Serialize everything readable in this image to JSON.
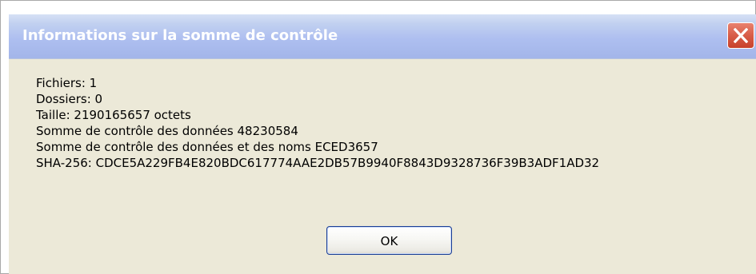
{
  "dialog": {
    "title": "Informations sur la somme de contrôle",
    "close_icon": "close-icon",
    "lines": [
      "Fichiers: 1",
      "Dossiers: 0",
      "Taille: 2190165657 octets",
      "Somme de contrôle des données 48230584",
      "Somme de contrôle des données et des noms ECED3657",
      "SHA-256: CDCE5A229FB4E820BDC617774AAE2DB57B9940F8843D9328736F39B3ADF1AD32"
    ],
    "ok_label": "OK"
  },
  "colors": {
    "title_bar": "#aebff0",
    "dialog_background": "#ece9d8",
    "close_button": "#d95f4b",
    "button_border": "#1c3f94"
  }
}
